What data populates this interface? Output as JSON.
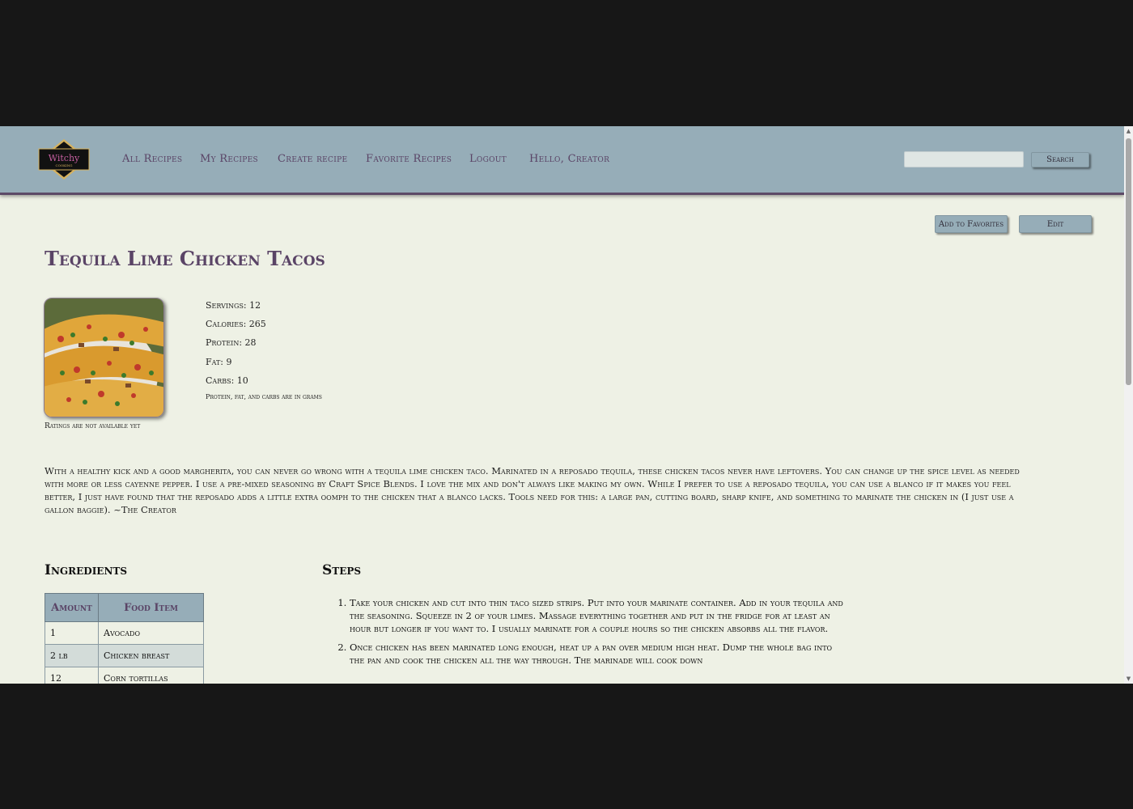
{
  "nav": {
    "logo_text": "Witchy",
    "logo_subtext": "COOKING",
    "links": [
      "All Recipes",
      "My Recipes",
      "Create recipe",
      "Favorite Recipes",
      "Logout",
      "Hello, Creator"
    ],
    "search_value": "",
    "search_button": "Search"
  },
  "actions": {
    "favorite": "Add to Favorites",
    "edit": "Edit"
  },
  "recipe": {
    "title": "Tequila Lime Chicken Tacos",
    "ratings_note": "Ratings are not available yet",
    "stats": {
      "servings": "Servings: 12",
      "calories": "Calories: 265",
      "protein": "Protein: 28",
      "fat": "Fat: 9",
      "carbs": "Carbs: 10",
      "note": "Protein, fat, and carbs are in grams"
    },
    "description": "With a healthy kick and a good margherita, you can never go wrong with a tequila lime chicken taco. Marinated in a reposado tequila, these chicken tacos never have leftovers. You can change up the spice level as needed with more or less cayenne pepper. I use a pre-mixed seasoning by Craft Spice Blends. I love the mix and don't always like making my own. While I prefer to use a reposado tequila, you can use a blanco if it makes you feel better, I just have found that the reposado adds a little extra oomph to the chicken that a blanco lacks. Tools need for this: a large pan, cutting board, sharp knife, and something to marinate the chicken in (I just use a gallon baggie). ~The Creator"
  },
  "ingredients": {
    "heading": "Ingredients",
    "columns": [
      "Amount",
      "Food Item"
    ],
    "rows": [
      {
        "amount": "1",
        "item": "Avocado"
      },
      {
        "amount": "2 lb",
        "item": "Chicken breast"
      },
      {
        "amount": "12",
        "item": "Corn tortillas"
      }
    ]
  },
  "steps": {
    "heading": "Steps",
    "items": [
      "Take your chicken and cut into thin taco sized strips. Put into your marinate container. Add in your tequila and the seasoning. Squeeze in 2 of your limes. Massage everything together and put in the fridge for at least an hour but longer if you want to. I usually marinate for a couple hours so the chicken absorbs all the flavor.",
      "Once chicken has been marinated long enough, heat up a pan over medium high heat. Dump the whole bag into the pan and cook the chicken all the way through. The marinade will cook down"
    ]
  },
  "colors": {
    "navbar": "#96adb8",
    "accent": "#5a4466",
    "page_bg": "#eef1e5",
    "outer_bg": "#171717"
  }
}
